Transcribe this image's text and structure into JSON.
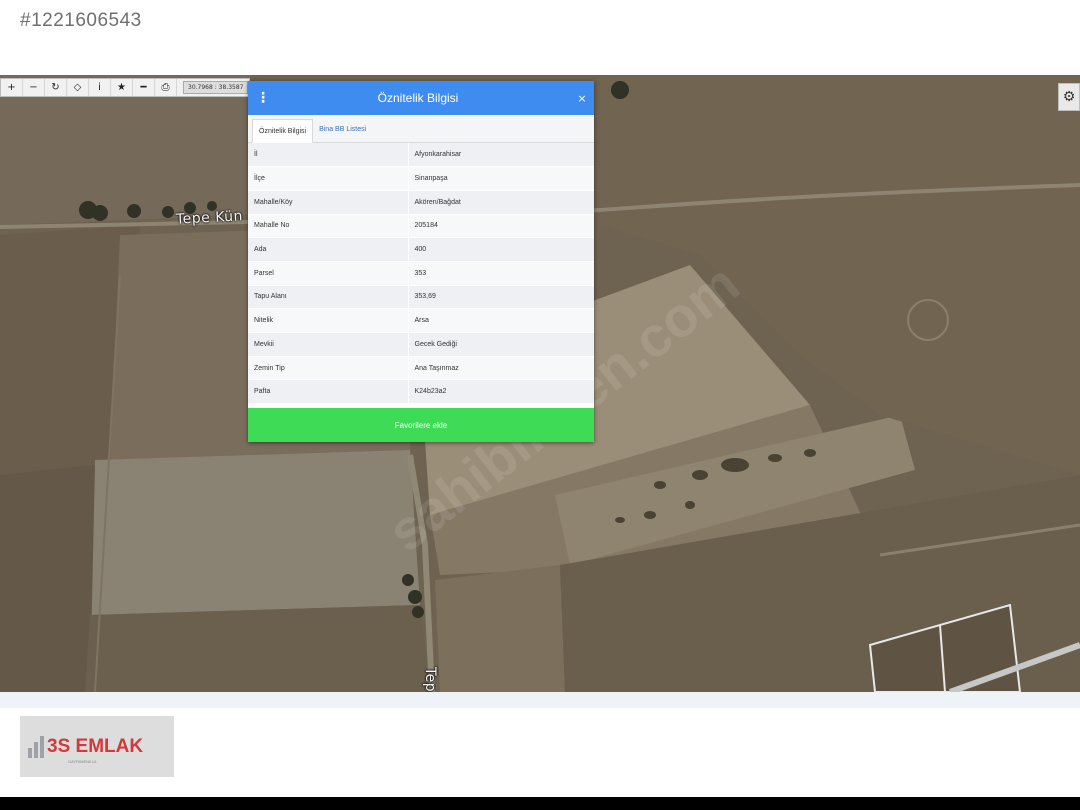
{
  "listing": {
    "id": "#1221606543"
  },
  "toolbar": {
    "buttons": [
      "+",
      "−",
      "↻",
      "◇",
      "i",
      "★",
      "━",
      "⎙"
    ],
    "coordinates": "30.7968 : 38.3587"
  },
  "map": {
    "road_label_horizontal": "Tepe Kün",
    "road_label_vertical": "Tepe",
    "watermark": "sahibinden.com",
    "settings_icon": "gear-icon"
  },
  "popup": {
    "title": "Öznitelik Bilgisi",
    "close": "×",
    "menu": "⋮",
    "tabs": [
      {
        "label": "Öznitelik Bilgisi"
      },
      {
        "label": "Bina BB Listesi"
      }
    ],
    "rows": [
      {
        "key": "İl",
        "value": "Afyonkarahisar"
      },
      {
        "key": "İlçe",
        "value": "Sinanpaşa"
      },
      {
        "key": "Mahalle/Köy",
        "value": "Akören/Bağdat"
      },
      {
        "key": "Mahalle No",
        "value": "205184"
      },
      {
        "key": "Ada",
        "value": "400"
      },
      {
        "key": "Parsel",
        "value": "353"
      },
      {
        "key": "Tapu Alanı",
        "value": "353,69"
      },
      {
        "key": "Nitelik",
        "value": "Arsa"
      },
      {
        "key": "Mevkii",
        "value": "Gecek Gediği"
      },
      {
        "key": "Zemin Tip",
        "value": "Ana Taşınmaz"
      },
      {
        "key": "Pafta",
        "value": "K24b23a2"
      }
    ],
    "favorite_button": "Favorilere ekle"
  },
  "footer": {
    "logo_text": "3S EMLAK",
    "logo_sub": "GAYRİMENKUL"
  },
  "colors": {
    "header_blue": "#3f8cf1",
    "favorite_green": "#3ddb56",
    "logo_red": "#d2393a"
  }
}
